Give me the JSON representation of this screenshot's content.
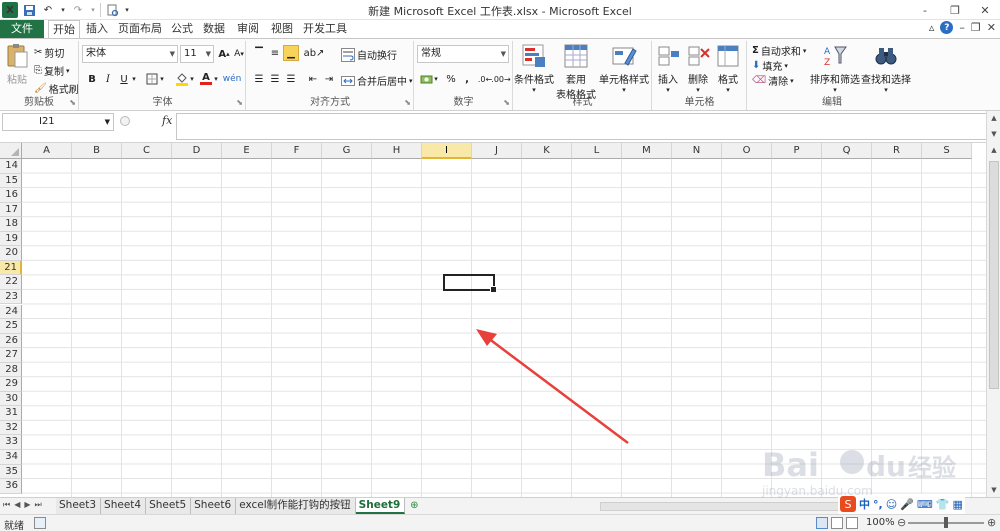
{
  "window": {
    "title": "新建 Microsoft Excel 工作表.xlsx - Microsoft Excel",
    "controls": [
      "-",
      "❐",
      "✕"
    ]
  },
  "tabs": [
    "文件",
    "开始",
    "插入",
    "页面布局",
    "公式",
    "数据",
    "审阅",
    "视图",
    "开发工具"
  ],
  "active_tab": "开始",
  "ribbon": {
    "clipboard": {
      "label": "剪贴板",
      "paste": "粘贴",
      "cut": "剪切",
      "copy": "复制",
      "format_painter": "格式刷"
    },
    "font": {
      "label": "字体",
      "name": "宋体",
      "size": "11",
      "bold": "B",
      "italic": "I",
      "underline": "U"
    },
    "alignment": {
      "label": "对齐方式",
      "wrap_text": "自动换行",
      "merge_center": "合并后居中"
    },
    "number": {
      "label": "数字",
      "format": "常规",
      "percent": "%",
      "comma": ","
    },
    "styles": {
      "label": "样式",
      "conditional": "条件格式",
      "table_format_1": "套用",
      "table_format_2": "表格格式",
      "cell_styles": "单元格样式"
    },
    "cells": {
      "label": "单元格",
      "insert": "插入",
      "delete": "删除",
      "format": "格式"
    },
    "editing": {
      "label": "编辑",
      "autosum": "自动求和",
      "fill": "填充",
      "clear": "清除",
      "sort_filter": "排序和筛选",
      "find_select": "查找和选择"
    }
  },
  "formula_bar": {
    "name_box": "I21",
    "fx": "fx",
    "content": ""
  },
  "columns": [
    "A",
    "B",
    "C",
    "D",
    "E",
    "F",
    "G",
    "H",
    "I",
    "J",
    "K",
    "L",
    "M",
    "N",
    "O",
    "P",
    "Q",
    "R",
    "S"
  ],
  "rows": [
    "14",
    "15",
    "16",
    "17",
    "18",
    "19",
    "20",
    "21",
    "22",
    "23",
    "24",
    "25",
    "26",
    "27",
    "28",
    "29",
    "30",
    "31",
    "32",
    "33",
    "34",
    "35",
    "36"
  ],
  "selected_cell": {
    "column": "I",
    "row": "21"
  },
  "sheets": [
    "Sheet3",
    "Sheet4",
    "Sheet5",
    "Sheet6",
    "excel制作能打钩的按钮",
    "Sheet9"
  ],
  "active_sheet": "Sheet9",
  "status": {
    "ready": "就绪",
    "zoom": "100%"
  },
  "ime": {
    "mode": "中"
  },
  "watermark": {
    "brand": "Bai",
    "brand2": "du",
    "brand3": "经验",
    "url": "jingyan.baidu.com"
  },
  "colors": {
    "excel_green": "#217346",
    "selection_highlight": "#f8e9a9",
    "annotation_arrow": "#e8403a"
  }
}
